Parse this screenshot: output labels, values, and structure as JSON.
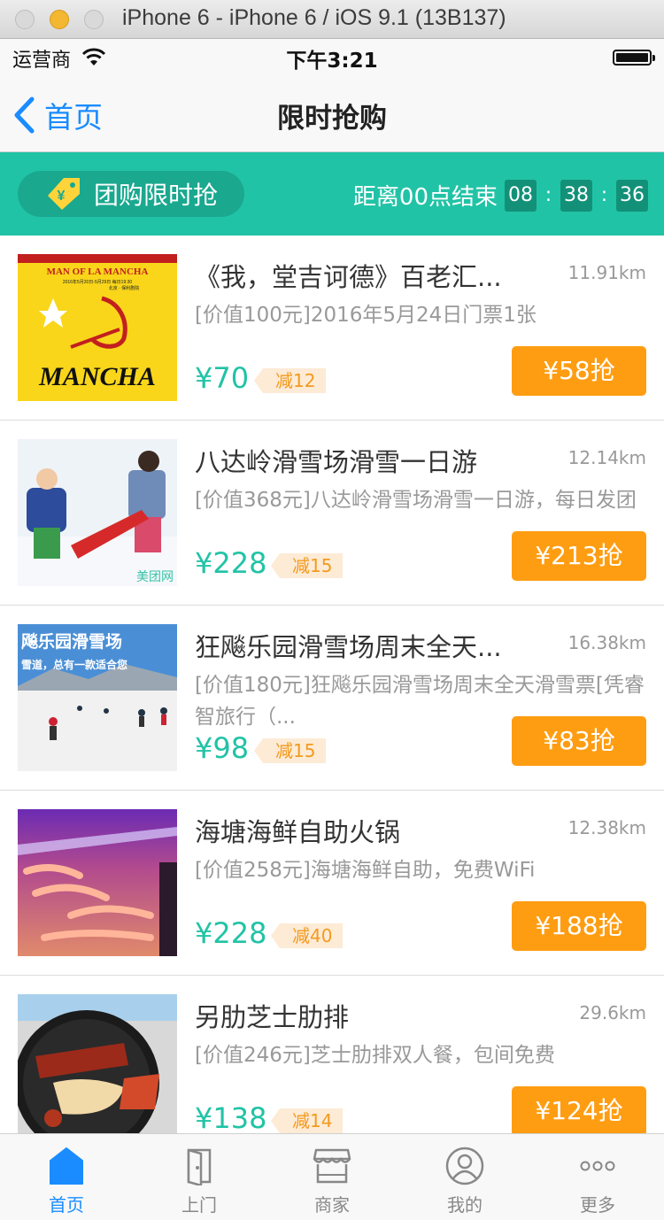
{
  "window": {
    "title": "iPhone 6 - iPhone 6 / iOS 9.1 (13B137)"
  },
  "status_bar": {
    "carrier": "运营商",
    "time": "下午3:21",
    "battery_level": 1.0
  },
  "nav": {
    "back_label": "首页",
    "title": "限时抢购"
  },
  "banner": {
    "pill_label": "团购限时抢",
    "countdown_label": "距离00点结束",
    "hours": "08",
    "minutes": "38",
    "seconds": "36",
    "separator": ":"
  },
  "deals": [
    {
      "title": "《我，堂吉诃德》百老汇...",
      "distance": "11.91km",
      "desc": "[价值100元]2016年5月24日门票1张",
      "price": "¥70",
      "discount": "减12",
      "button": "¥58抢",
      "image_text": {
        "top": "MAN OF LA MANCHA",
        "sub": "2016年5月20日-5月29日  每日19:30",
        "venue": "北京 · 保利剧院",
        "logo": "MANCHA"
      }
    },
    {
      "title": "八达岭滑雪场滑雪一日游",
      "distance": "12.14km",
      "desc": "[价值368元]八达岭滑雪场滑雪一日游，每日发团",
      "price": "¥228",
      "discount": "减15",
      "button": "¥213抢",
      "image_text": {
        "watermark": "美团网"
      }
    },
    {
      "title": "狂飚乐园滑雪场周末全天...",
      "distance": "16.38km",
      "desc": "[价值180元]狂飚乐园滑雪场周末全天滑雪票[凭睿智旅行（...",
      "price": "¥98",
      "discount": "减15",
      "button": "¥83抢",
      "image_text": {
        "headline": "飚乐园滑雪场",
        "sub": "雪道，总有一款适合您"
      }
    },
    {
      "title": "海塘海鲜自助火锅",
      "distance": "12.38km",
      "desc": "[价值258元]海塘海鲜自助，免费WiFi",
      "price": "¥228",
      "discount": "减40",
      "button": "¥188抢"
    },
    {
      "title": "另肋芝士肋排",
      "distance": "29.6km",
      "desc": "[价值246元]芝士肋排双人餐，包间免费",
      "price": "¥138",
      "discount": "减14",
      "button": "¥124抢"
    }
  ],
  "tabs": [
    {
      "label": "首页",
      "icon": "home-icon",
      "active": true
    },
    {
      "label": "上门",
      "icon": "door-icon",
      "active": false
    },
    {
      "label": "商家",
      "icon": "shop-icon",
      "active": false
    },
    {
      "label": "我的",
      "icon": "user-icon",
      "active": false
    },
    {
      "label": "更多",
      "icon": "more-icon",
      "active": false
    }
  ],
  "colors": {
    "accent": "#21c3a6",
    "link": "#1a8cff",
    "button": "#ff9d12",
    "badge_text": "#f39a1e"
  }
}
